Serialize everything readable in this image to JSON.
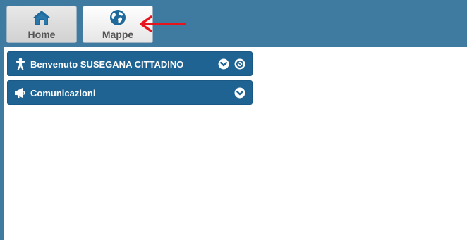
{
  "toolbar": {
    "home_label": "Home",
    "maps_label": "Mappe"
  },
  "panels": [
    {
      "title": "Benvenuto SUSEGANA CITTADINO",
      "icon": "person-icon"
    },
    {
      "title": "Comunicazioni",
      "icon": "megaphone-icon"
    }
  ],
  "colors": {
    "background": "#3f7aa1",
    "panel": "#1e6392",
    "arrow": "#e8141c",
    "icon_blue": "#1f6a9a"
  }
}
